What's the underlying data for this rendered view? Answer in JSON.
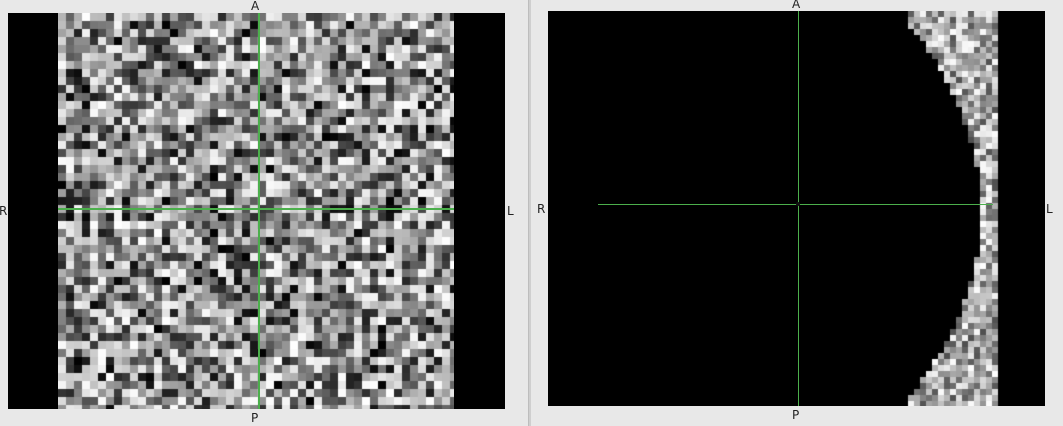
{
  "views": [
    {
      "name": "left",
      "labels": {
        "top": "A",
        "bottom": "P",
        "left": "R",
        "right": "L"
      }
    },
    {
      "name": "right",
      "labels": {
        "top": "A",
        "bottom": "P",
        "left": "R",
        "right": "L"
      }
    }
  ],
  "colors": {
    "crosshair": "#4caf4c",
    "background": "#000000",
    "panel": "#e8e8e8"
  }
}
